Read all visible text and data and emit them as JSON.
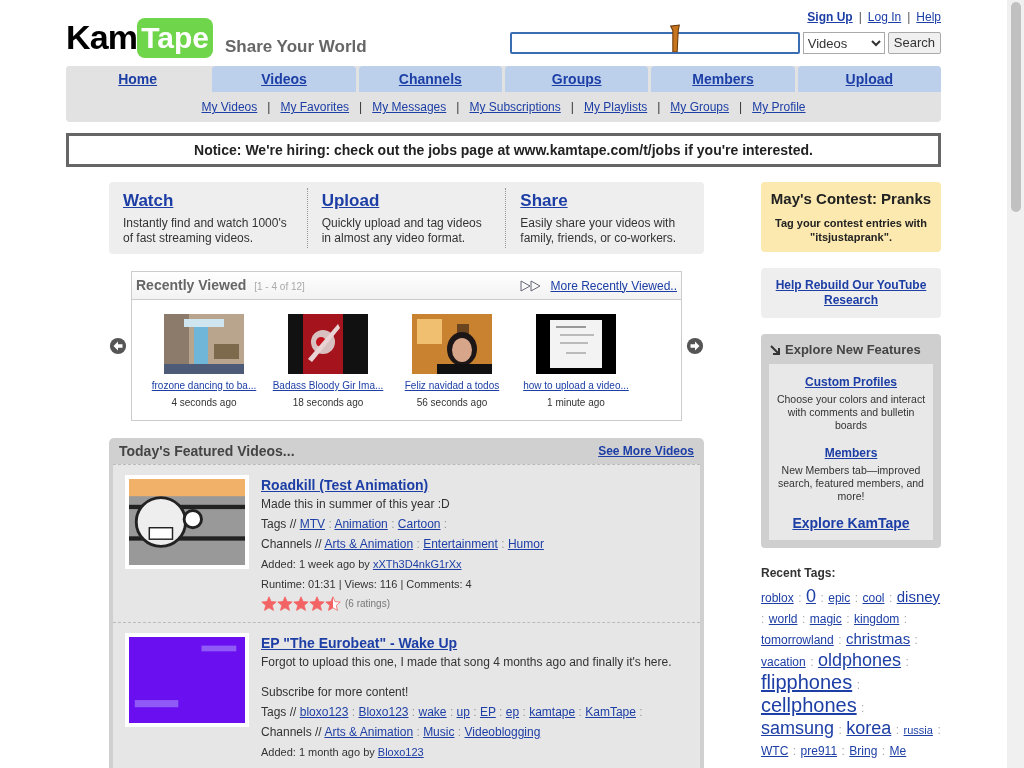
{
  "logo": {
    "left": "Kam",
    "right": "Tape"
  },
  "tagline": "Share Your World",
  "account_links": [
    "Sign Up",
    "Log In",
    "Help"
  ],
  "search": {
    "category": "Videos",
    "button": "Search"
  },
  "separators": {
    "links": "|",
    "tags": ":"
  },
  "tabs": [
    {
      "label": "Home",
      "selected": true
    },
    {
      "label": "Videos",
      "selected": false
    },
    {
      "label": "Channels",
      "selected": false
    },
    {
      "label": "Groups",
      "selected": false
    },
    {
      "label": "Members",
      "selected": false
    },
    {
      "label": "Upload",
      "selected": false
    }
  ],
  "sub_links": [
    "My Videos",
    "My Favorites",
    "My Messages",
    "My Subscriptions",
    "My Playlists",
    "My Groups",
    "My Profile"
  ],
  "notice": "Notice: We're hiring: check out the jobs page at www.kamtape.com/t/jobs if you're interested.",
  "intro": [
    {
      "title": "Watch",
      "text": "Instantly find and watch 1000's of fast streaming videos."
    },
    {
      "title": "Upload",
      "text": "Quickly upload and tag videos in almost any video format."
    },
    {
      "title": "Share",
      "text": "Easily share your videos with family, friends, or co-workers."
    }
  ],
  "recently_viewed": {
    "title": "Recently Viewed",
    "range": "[1 - 4 of 12]",
    "more": "More Recently Viewed..",
    "items": [
      {
        "title": "frozone dancing to ba...",
        "time": "4 seconds ago",
        "kind": "picture"
      },
      {
        "title": "Badass Bloody Gir Ima...",
        "time": "18 seconds ago",
        "kind": "picture"
      },
      {
        "title": "Feliz navidad a todos",
        "time": "56 seconds ago",
        "kind": "picture"
      },
      {
        "title": "how to upload a video...",
        "time": "1 minute ago",
        "kind": "picture"
      }
    ]
  },
  "featured": {
    "title": "Today's Featured Videos...",
    "more": "See More Videos",
    "videos": [
      {
        "title": "Roadkill (Test Animation)",
        "description": [
          "Made this in summer of this year :D"
        ],
        "kind": "picture",
        "tags_label": "Tags //",
        "tags": [
          "MTV",
          "Animation",
          "Cartoon"
        ],
        "channels_label": "Channels //",
        "channels": [
          "Arts & Animation",
          "Entertainment",
          "Humor"
        ],
        "added": "Added: 1 week ago by",
        "author": "xXTh3D4nkG1rXx",
        "stats": "Runtime: 01:31 | Views: 116 | Comments: 4",
        "stars": 4.5,
        "ratings": "(6 ratings)"
      },
      {
        "title": "EP \"The Eurobeat\" - Wake Up",
        "description": [
          "Forgot to upload this one, I made that song 4 months ago and finally it's here.",
          "Subscribe for more content!"
        ],
        "kind": "picture",
        "tags_label": "Tags //",
        "tags": [
          "bloxo123",
          "Bloxo123",
          "wake",
          "up",
          "EP",
          "ep",
          "kamtape",
          "KamTape"
        ],
        "channels_label": "Channels //",
        "channels": [
          "Arts & Animation",
          "Music",
          "Videoblogging"
        ],
        "added": "Added: 1 month ago by",
        "author": "Bloxo123"
      }
    ]
  },
  "contest": {
    "title": "May's Contest: Pranks",
    "text": "Tag your contest entries with \"itsjustaprank\"."
  },
  "research_link": "Help Rebuild Our YouTube Research",
  "explore": {
    "title": "Explore New Features",
    "items": [
      {
        "title": "Custom Profiles",
        "text": "Choose your colors and interact with comments and bulletin boards"
      },
      {
        "title": "Members",
        "text": "New Members tab—improved search, featured members, and more!"
      }
    ],
    "link": "Explore KamTape"
  },
  "recent_tags": {
    "title": "Recent Tags:",
    "tags": [
      {
        "label": "roblox",
        "kind": "small"
      },
      {
        "label": "0",
        "kind": "large"
      },
      {
        "label": "epic",
        "kind": "small"
      },
      {
        "label": "cool",
        "kind": "small"
      },
      {
        "label": "disney",
        "kind": "medium"
      },
      {
        "label": "world",
        "kind": "small"
      },
      {
        "label": "magic",
        "kind": "small"
      },
      {
        "label": "kingdom",
        "kind": "small"
      },
      {
        "label": "tomorrowland",
        "kind": "small"
      },
      {
        "label": "christmas",
        "kind": "medium"
      },
      {
        "label": "vacation",
        "kind": "small"
      },
      {
        "label": "oldphones",
        "kind": "large"
      },
      {
        "label": "flipphones",
        "kind": "huge"
      },
      {
        "label": "cellphones",
        "kind": "huge"
      },
      {
        "label": "samsung",
        "kind": "large"
      },
      {
        "label": "korea",
        "kind": "large"
      },
      {
        "label": "russia",
        "kind": "tiny"
      },
      {
        "label": "WTC",
        "kind": "small"
      },
      {
        "label": "pre911",
        "kind": "small"
      },
      {
        "label": "Bring",
        "kind": "small"
      },
      {
        "label": "Me",
        "kind": "small"
      }
    ]
  }
}
